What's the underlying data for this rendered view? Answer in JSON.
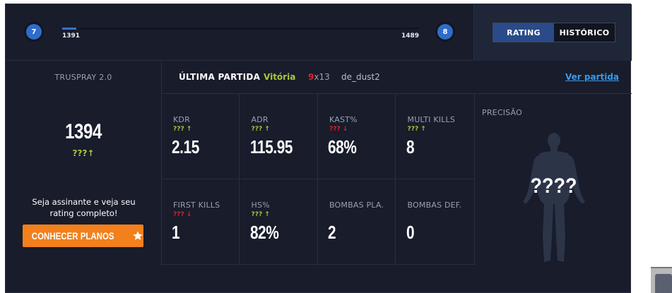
{
  "progress": {
    "level_current": "7",
    "level_next": "8",
    "xp_min": "1391",
    "xp_max": "1489",
    "fill_fraction": 0.04
  },
  "tabs": {
    "rating": "RATING",
    "historico": "HISTÓRICO",
    "active": "rating"
  },
  "sidebar": {
    "title": "TRUSPRAY 2.0",
    "rating_value": "1394",
    "rating_delta": "???",
    "promo_text": "Seja assinante e veja seu rating completo!",
    "button_label": "CONHECER PLANOS",
    "button_icon": "star-icon"
  },
  "last_match": {
    "label": "ÚLTIMA PARTIDA",
    "result": "Vitória",
    "score_a": "9",
    "score_sep": "x",
    "score_b": "13",
    "map": "de_dust2",
    "link": "Ver partida"
  },
  "stats": [
    {
      "label": "KDR",
      "delta": "???",
      "trend": "up",
      "value": "2.15"
    },
    {
      "label": "ADR",
      "delta": "???",
      "trend": "up",
      "value": "115.95"
    },
    {
      "label": "KAST%",
      "delta": "???",
      "trend": "down",
      "value": "68%"
    },
    {
      "label": "MULTI KILLS",
      "delta": "???",
      "trend": "up",
      "value": "8"
    },
    {
      "label": "FIRST KILLS",
      "delta": "???",
      "trend": "down",
      "value": "1"
    },
    {
      "label": "HS%",
      "delta": "???",
      "trend": "up",
      "value": "82%"
    },
    {
      "label": "BOMBAS PLA.",
      "delta": "",
      "trend": "",
      "value": "2"
    },
    {
      "label": "BOMBAS DEF.",
      "delta": "",
      "trend": "",
      "value": "0"
    }
  ],
  "precision": {
    "title": "PRECISÃO",
    "value": "????"
  },
  "colors": {
    "accent_blue": "#2f6cc9",
    "accent_orange": "#f2801c",
    "positive": "#a8c83a",
    "negative": "#e0202a",
    "link": "#3a9ae8",
    "panel_bg": "#181c2b"
  }
}
